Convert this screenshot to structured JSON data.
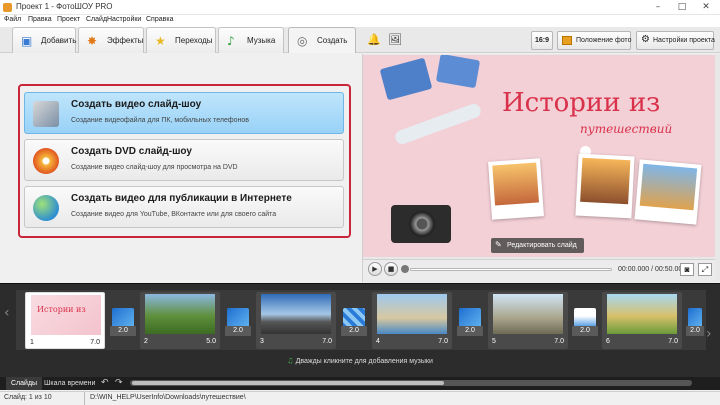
{
  "window": {
    "title": "Проект 1 - ФотоШОУ PRO"
  },
  "menu": [
    "Файл",
    "Правка",
    "Проект",
    "Слайд",
    "Настройки",
    "Справка"
  ],
  "tabs": [
    {
      "label": "Добавить",
      "icon": "add-folder-icon"
    },
    {
      "label": "Эффекты",
      "icon": "effects-icon"
    },
    {
      "label": "Переходы",
      "icon": "star-icon"
    },
    {
      "label": "Музыка",
      "icon": "music-note-icon"
    },
    {
      "label": "Создать",
      "icon": "film-reel-icon"
    }
  ],
  "toolbar": {
    "aspect": "16:9",
    "photo_position": "Положение фото",
    "project_settings": "Настройки проекта"
  },
  "options": [
    {
      "title": "Создать видео слайд-шоу",
      "desc": "Создание видеофайла для ПК, мобильных телефонов"
    },
    {
      "title": "Создать DVD слайд-шоу",
      "desc": "Создание видео слайд-шоу для просмотра на DVD"
    },
    {
      "title": "Создать видео для публикации в Интернете",
      "desc": "Создание видео для YouTube, ВКонтакте или для своего сайта"
    }
  ],
  "preview": {
    "title": "Истории из",
    "subtitle": "путешествий",
    "edit_slide": "Редактировать слайд"
  },
  "player": {
    "time": "00:00.000 / 00:50.000",
    "progress": 0
  },
  "slides": [
    {
      "num": "1",
      "dur": "7.0"
    },
    {
      "num": "2",
      "dur": "5.0"
    },
    {
      "num": "3",
      "dur": "7.0"
    },
    {
      "num": "4",
      "dur": "7.0"
    },
    {
      "num": "5",
      "dur": "7.0"
    },
    {
      "num": "6",
      "dur": "7.0"
    }
  ],
  "transitions": [
    "2.0",
    "2.0",
    "2.0",
    "2.0",
    "2.0",
    "2.0"
  ],
  "music_hint": "Дважды кликните для добавления музыки",
  "bottom_tabs": [
    "Слайды",
    "Шкала времени"
  ],
  "status": {
    "slide": "Слайд: 1 из 10",
    "path": "D:\\WIN_HELP\\UserInfo\\Downloads\\путешествие\\"
  },
  "colors": {
    "accent_red": "#c8263a",
    "selected_blue": "#98d2f7",
    "preview_pink": "#f3cfd6"
  }
}
